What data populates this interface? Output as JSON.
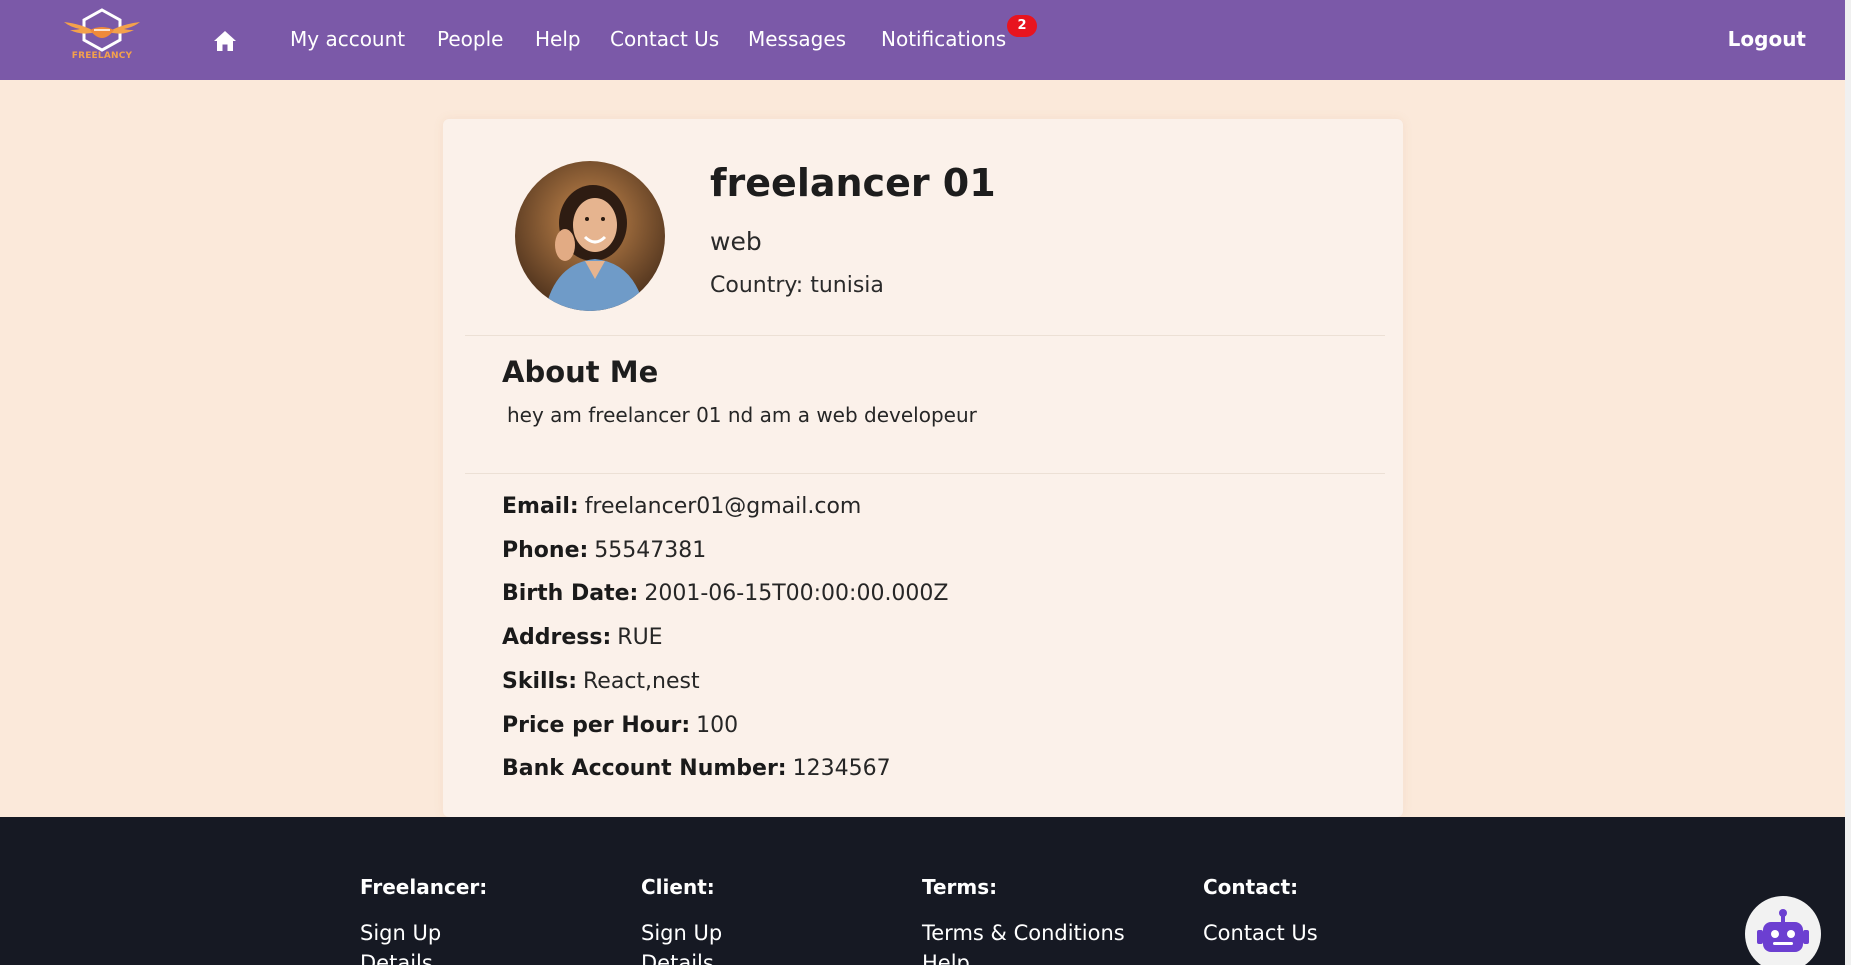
{
  "brand": {
    "logo_text": "FREELANCY",
    "accent": "#f4a14b",
    "nav_bg": "#7b59a8"
  },
  "nav": {
    "home_icon": "home-icon",
    "links": [
      "My account",
      "People",
      "Help",
      "Contact Us",
      "Messages",
      "Notifications"
    ],
    "notification_count": "2",
    "logout": "Logout"
  },
  "profile": {
    "name": "freelancer 01",
    "role": "web",
    "country": "Country: tunisia",
    "about_title": "About Me",
    "about_text": "hey am freelancer 01 nd am a web developeur",
    "details": [
      {
        "label": "Email:",
        "value": "freelancer01@gmail.com"
      },
      {
        "label": "Phone:",
        "value": "55547381"
      },
      {
        "label": "Birth Date:",
        "value": "2001-06-15T00:00:00.000Z"
      },
      {
        "label": "Address:",
        "value": "RUE"
      },
      {
        "label": "Skills:",
        "value": "React,nest"
      },
      {
        "label": "Price per Hour:",
        "value": "100"
      },
      {
        "label": "Bank Account Number:",
        "value": "1234567"
      }
    ]
  },
  "footer": {
    "bg": "#161923",
    "columns": [
      {
        "heading": "Freelancer:",
        "links": [
          "Sign Up",
          "Details"
        ]
      },
      {
        "heading": "Client:",
        "links": [
          "Sign Up",
          "Details"
        ]
      },
      {
        "heading": "Terms:",
        "links": [
          "Terms & Conditions",
          "Help"
        ]
      },
      {
        "heading": "Contact:",
        "links": [
          "Contact Us"
        ]
      }
    ]
  },
  "chatbot": {
    "icon": "robot-icon"
  }
}
